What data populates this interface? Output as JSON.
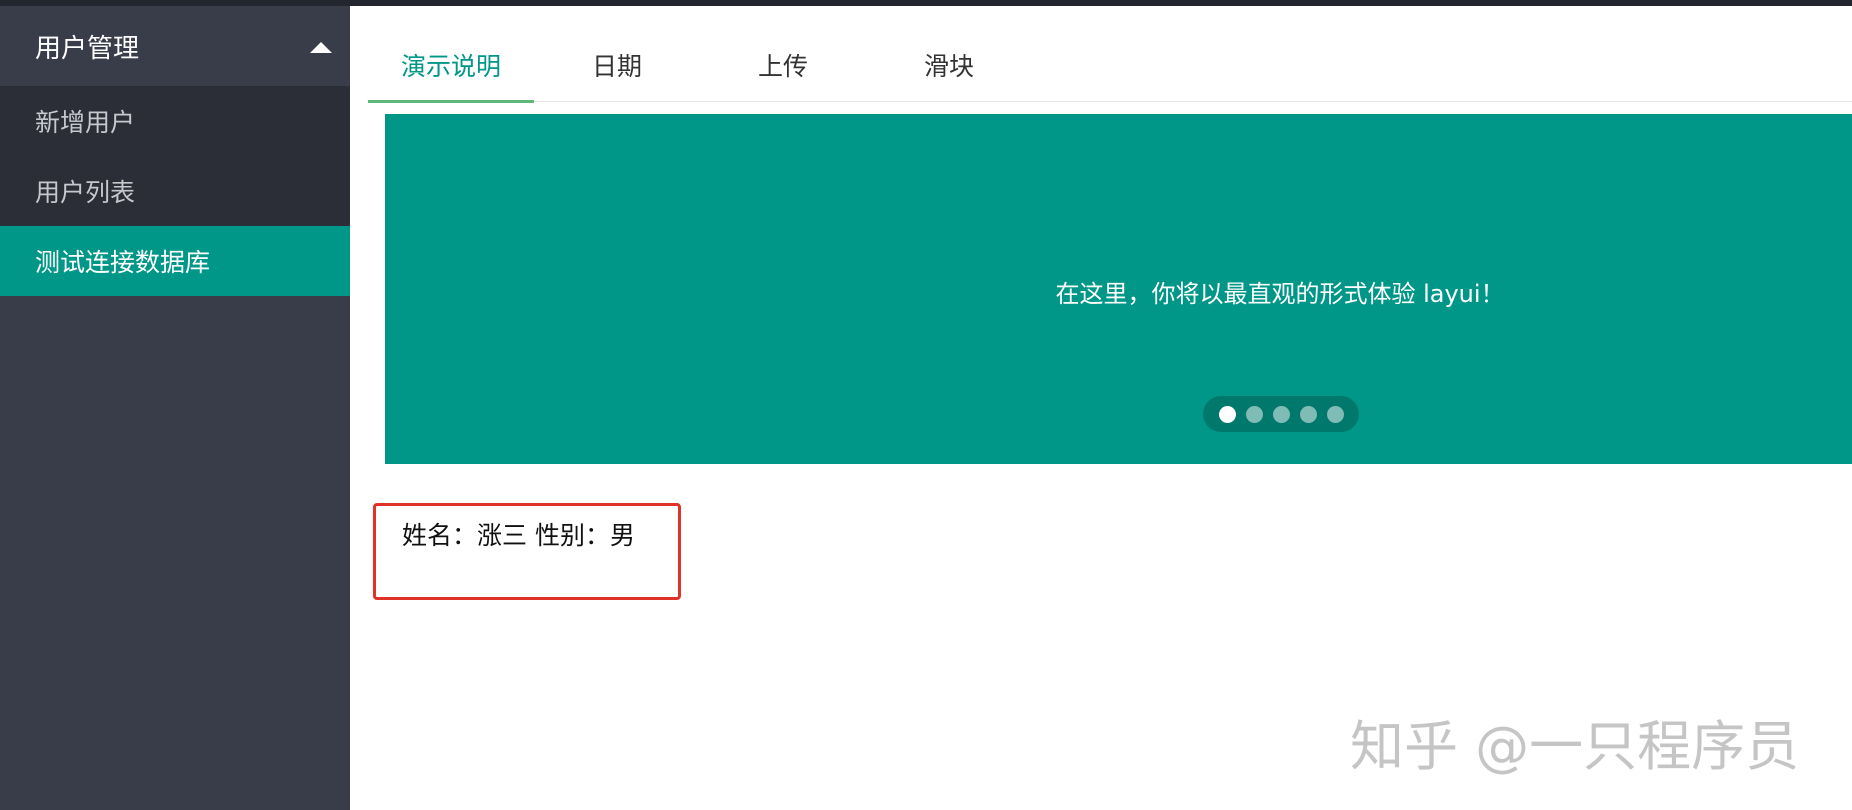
{
  "sidebar": {
    "group_label": "用户管理",
    "items": [
      {
        "label": "新增用户"
      },
      {
        "label": "用户列表"
      },
      {
        "label": "测试连接数据库"
      }
    ]
  },
  "tabs": [
    {
      "label": "演示说明"
    },
    {
      "label": "日期"
    },
    {
      "label": "上传"
    },
    {
      "label": "滑块"
    }
  ],
  "carousel": {
    "text": "在这里，你将以最直观的形式体验 layui！",
    "dot_count": 5,
    "active_index": 0
  },
  "content": {
    "info_text": "姓名：涨三 性别：男"
  },
  "watermark": "知乎 @一只程序员",
  "colors": {
    "accent": "#009688",
    "sidebar_bg": "#393d49",
    "highlight_border": "#e03327"
  }
}
